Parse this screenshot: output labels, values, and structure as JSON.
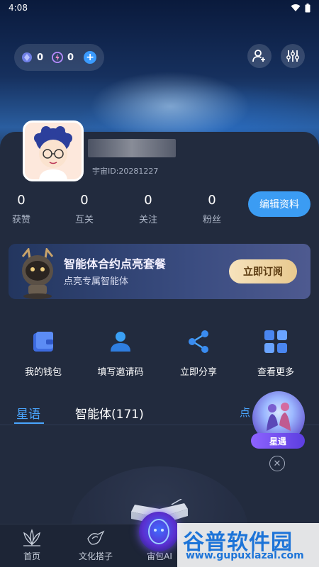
{
  "status_bar": {
    "time": "4:08"
  },
  "header": {
    "coin1_value": "0",
    "coin2_value": "0",
    "plus": "+"
  },
  "profile": {
    "uid_label": "宇宙ID:20281227"
  },
  "stats": [
    {
      "value": "0",
      "label": "获赞"
    },
    {
      "value": "0",
      "label": "互关"
    },
    {
      "value": "0",
      "label": "关注"
    },
    {
      "value": "0",
      "label": "粉丝"
    }
  ],
  "edit_button": "编辑资料",
  "banner": {
    "title": "智能体合约点亮套餐",
    "subtitle": "点亮专属智能体",
    "button": "立即订阅"
  },
  "quick_actions": [
    {
      "label": "我的钱包",
      "icon": "wallet-icon"
    },
    {
      "label": "填写邀请码",
      "icon": "person-icon"
    },
    {
      "label": "立即分享",
      "icon": "share-icon"
    },
    {
      "label": "查看更多",
      "icon": "grid-icon"
    }
  ],
  "tabs": {
    "active": "星语",
    "second": "智能体(171)",
    "right": "点"
  },
  "floating": {
    "badge": "星遇",
    "close": "✕"
  },
  "bottom_nav": [
    {
      "label": "首页",
      "icon": "lotus-icon"
    },
    {
      "label": "文化搭子",
      "icon": "bird-icon"
    },
    {
      "label": "宙包AI",
      "icon": "ai-orb-icon"
    }
  ],
  "watermark": {
    "title": "谷普软件园",
    "url": "www.gupuxlazal.com"
  },
  "colors": {
    "accent": "#3b9cf3",
    "tab_active": "#4aa6ff",
    "card_bg": "#222b3e"
  }
}
